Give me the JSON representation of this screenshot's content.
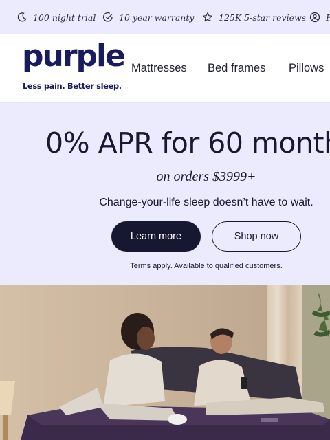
{
  "trust_bar": {
    "items": [
      {
        "icon": "moon-icon",
        "label": "100 night trial"
      },
      {
        "icon": "check-circle-icon",
        "label": "10 year warranty"
      },
      {
        "icon": "star-icon",
        "label": "125K 5-star reviews"
      },
      {
        "icon": "support-icon",
        "label": "F"
      }
    ]
  },
  "header": {
    "logo_word": "purple",
    "logo_tagline": "Less pain. Better sleep.",
    "nav": [
      "Mattresses",
      "Bed frames",
      "Pillows"
    ]
  },
  "promo": {
    "headline": "0% APR for 60 month",
    "subheadline": "on orders $3999+",
    "description": "Change-your-life sleep doesn’t have to wait.",
    "primary_button": "Learn more",
    "secondary_button": "Shop now",
    "terms": "Terms apply. Available to qualified customers.",
    "background": "#ecebfd",
    "button_dark": "#161730"
  },
  "hero": {
    "image_subject": "couple-on-purple-mattress-photo",
    "mattress_color": "#3b2a4a"
  },
  "colors": {
    "brand": "#1a1b5e",
    "lavender": "#ecebfd"
  }
}
